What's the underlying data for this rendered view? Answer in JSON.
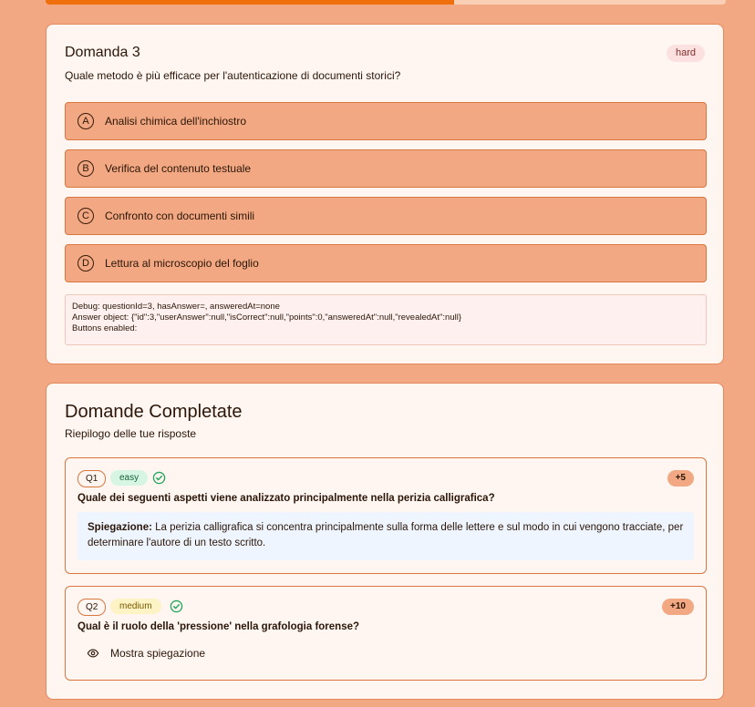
{
  "progress": {
    "fraction": 0.6
  },
  "question": {
    "title": "Domanda 3",
    "difficulty": "hard",
    "text": "Quale metodo è più efficace per l'autenticazione di documenti storici?",
    "options": [
      {
        "letter": "A",
        "label": "Analisi chimica dell'inchiostro"
      },
      {
        "letter": "B",
        "label": "Verifica del contenuto testuale"
      },
      {
        "letter": "C",
        "label": "Confronto con documenti simili"
      },
      {
        "letter": "D",
        "label": "Lettura al microscopio del foglio"
      }
    ],
    "debug": {
      "line1": "Debug: questionId=3, hasAnswer=, answeredAt=none",
      "line2": "Answer object: {\"id\":3,\"userAnswer\":null,\"isCorrect\":null,\"points\":0,\"answeredAt\":null,\"revealedAt\":null}",
      "line3": "Buttons enabled:"
    }
  },
  "completed": {
    "title": "Domande Completate",
    "subtitle": "Riepilogo delle tue risposte",
    "answers": [
      {
        "id": "Q1",
        "level": "easy",
        "points": "+5",
        "question": "Quale dei seguenti aspetti viene analizzato principalmente nella perizia calligrafica?",
        "explanation_label": "Spiegazione:",
        "explanation": "La perizia calligrafica si concentra principalmente sulla forma delle lettere e sul modo in cui vengono tracciate, per determinare l'autore di un testo scritto."
      },
      {
        "id": "Q2",
        "level": "medium",
        "points": "+10",
        "question": "Qual è il ruolo della 'pressione' nella grafologia forense?",
        "show_explanation_label": "Mostra spiegazione"
      }
    ]
  },
  "icons": {
    "check": "check-circle-icon",
    "eye": "eye-icon"
  },
  "colors": {
    "accent": "#ef6f0c",
    "background": "#f2a882",
    "success": "#22a55a"
  }
}
